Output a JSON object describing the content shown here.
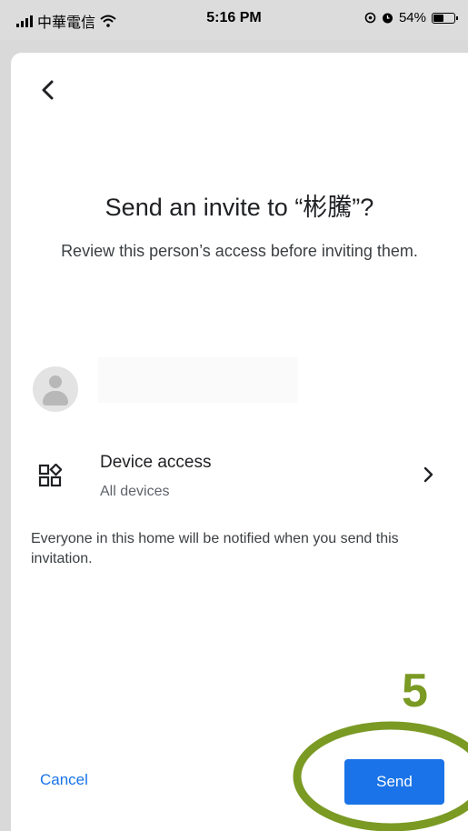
{
  "status_bar": {
    "carrier": "中華電信",
    "time": "5:16 PM",
    "battery_percent": "54%",
    "battery_level": 0.54,
    "icons": [
      "signal-icon",
      "wifi-icon",
      "location-icon",
      "alarm-icon",
      "battery-icon"
    ]
  },
  "header": {
    "back_icon": "chevron-left-icon"
  },
  "invite": {
    "title": "Send an invite to “彬騰”?",
    "subtitle": "Review this person’s access before inviting them."
  },
  "device_access": {
    "title": "Device access",
    "value": "All devices",
    "icon": "device-grid-icon",
    "chevron_icon": "chevron-right-icon"
  },
  "notice": "Everyone in this home will be notified when you send this invitation.",
  "actions": {
    "cancel_label": "Cancel",
    "send_label": "Send"
  },
  "annotation": {
    "step_number": "5",
    "color": "#7a9a24"
  },
  "colors": {
    "accent": "#1a73e8",
    "text_primary": "#202124",
    "text_secondary": "#5f6368"
  }
}
